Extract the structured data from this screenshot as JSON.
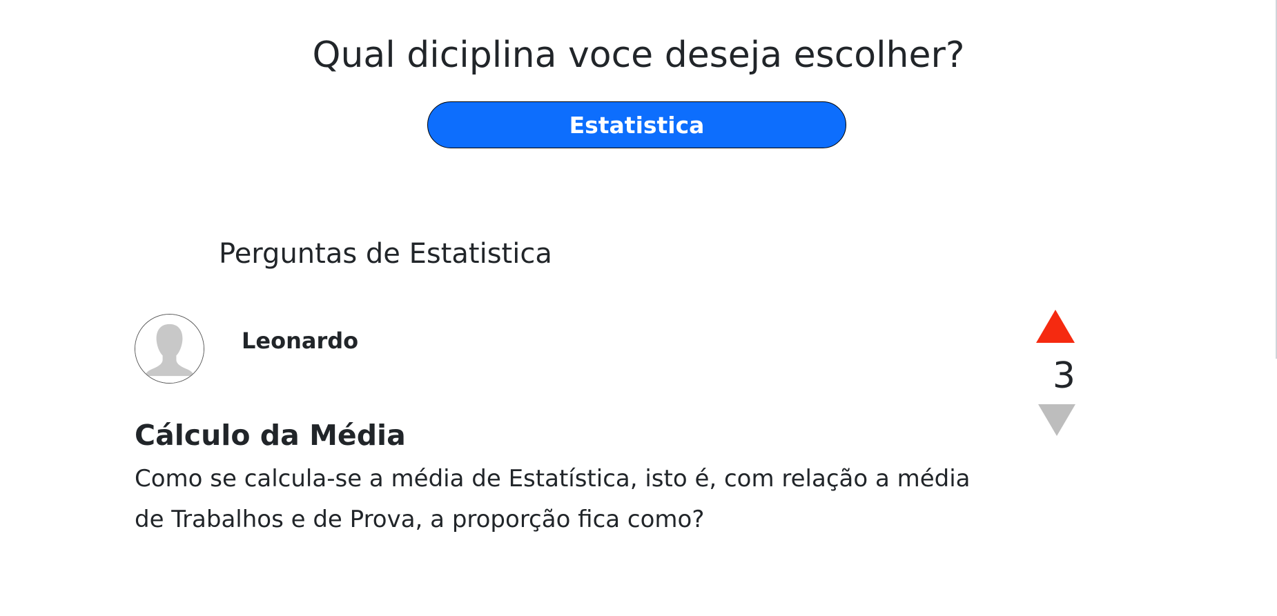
{
  "header": {
    "title": "Qual diciplina voce deseja escolher?",
    "selected_discipline": "Estatistica"
  },
  "section": {
    "title": "Perguntas de Estatistica"
  },
  "question": {
    "author": "Leonardo",
    "avatar_icon": "user-silhouette-icon",
    "title": "Cálculo da Média",
    "body": "Como se calcula-se a média de Estatística, isto é, com relação a média de Trabalhos e de Prova, a proporção fica como?",
    "votes": "3",
    "upvote_icon": "triangle-up-icon",
    "downvote_icon": "triangle-down-icon"
  },
  "colors": {
    "primary": "#0d6efd",
    "upvote_active": "#f52a10",
    "downvote_inactive": "#bdbdbd",
    "text": "#212529"
  }
}
